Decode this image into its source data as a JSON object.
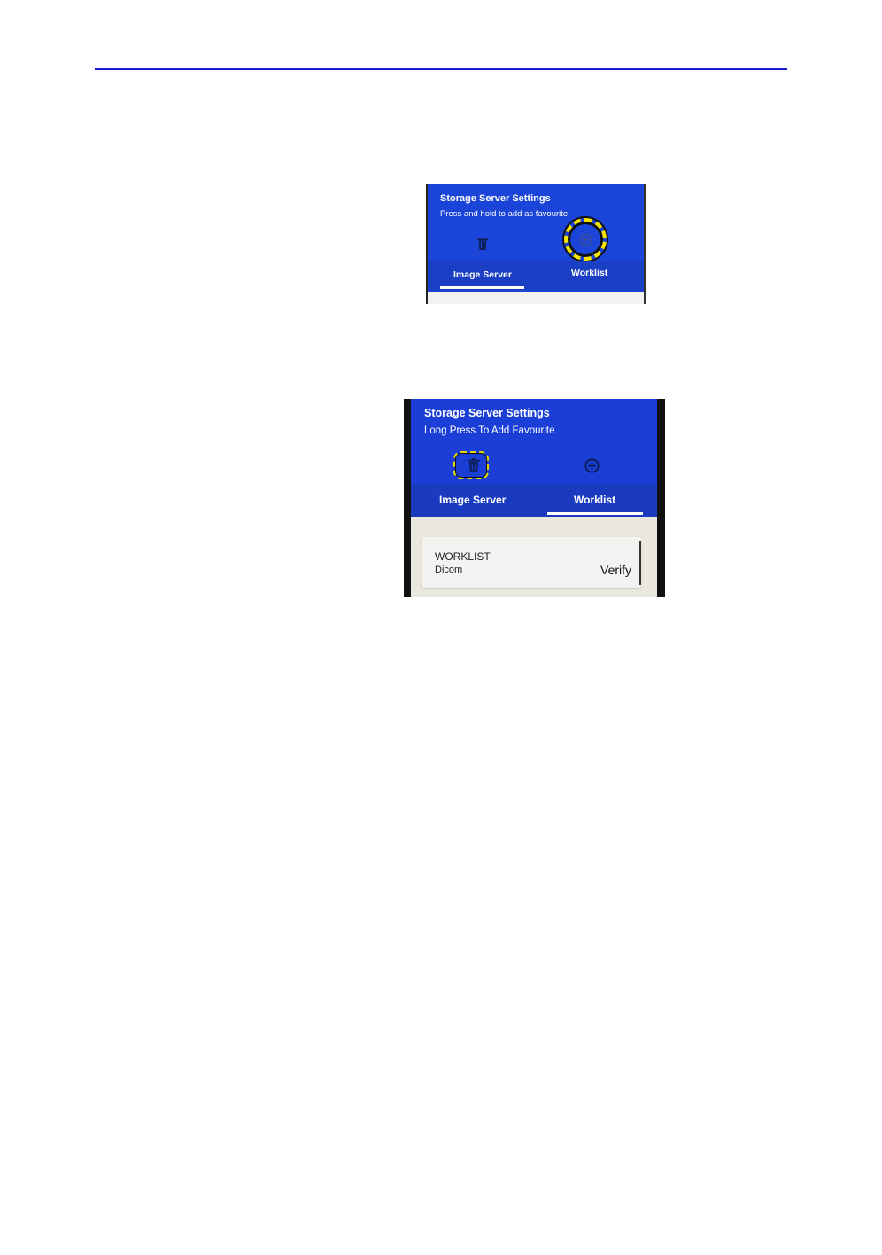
{
  "colors": {
    "rule": "#1a1ad0",
    "header_blue": "#1b45d8",
    "highlight_yellow": "#f5e400"
  },
  "screenshot1": {
    "title": "Storage Server Settings",
    "subtitle": "Press and hold to add as favourite",
    "tabs": [
      {
        "label": "Image Server",
        "selected": true,
        "icon": "trash-icon"
      },
      {
        "label": "Worklist",
        "selected": false,
        "icon": "add-circle-icon",
        "highlighted": true
      }
    ]
  },
  "screenshot2": {
    "title": "Storage Server Settings",
    "subtitle": "Long Press To Add Favourite",
    "tabs": [
      {
        "label": "Image Server",
        "selected": false,
        "icon": "trash-icon",
        "highlighted": true
      },
      {
        "label": "Worklist",
        "selected": true,
        "icon": "add-circle-icon"
      }
    ],
    "worklist_item": {
      "name": "WORKLIST",
      "type": "Dicom",
      "action": "Verify"
    }
  }
}
